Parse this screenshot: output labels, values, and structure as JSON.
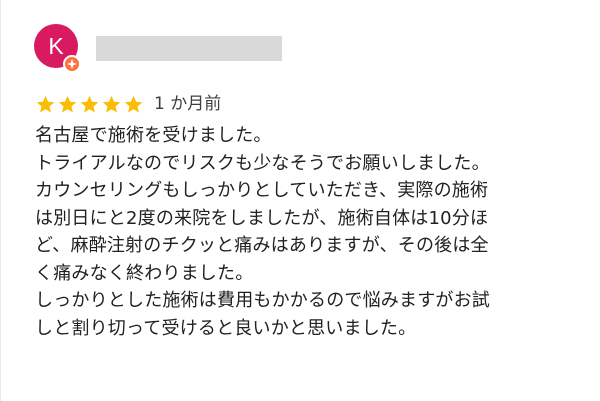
{
  "review": {
    "avatar_letter": "K",
    "guide_badge_icon": "local-guide-badge-icon",
    "rating": 5,
    "rating_max": 5,
    "star_icon": "star-icon",
    "time_ago": "1 か月前",
    "text_lines": [
      "名古屋で施術を受けました。",
      "トライアルなのでリスクも少なそうでお願いしました。",
      "カウンセリングもしっかりとしていただき、実際の施術",
      "は別日にと2度の来院をしましたが、施術自体は10分ほ",
      "ど、麻酔注射のチクッと痛みはありますが、その後は全",
      "く痛みなく終わりました。",
      "しっかりとした施術は費用もかかるので悩みますがお試",
      "しと割り切って受けると良いかと思いました。"
    ]
  },
  "colors": {
    "avatar_bg": "#d81b60",
    "badge_bg": "#ff7043",
    "star": "#fbbc04",
    "redaction": "#d9d9d9"
  }
}
